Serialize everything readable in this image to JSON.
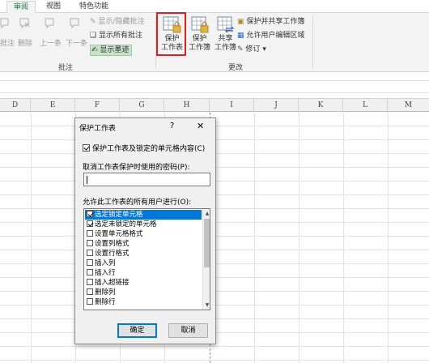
{
  "ribbon": {
    "tabs": [
      {
        "label": "审阅",
        "active": true
      },
      {
        "label": "视图",
        "active": false
      },
      {
        "label": "特色功能",
        "active": false
      }
    ],
    "comments_group": {
      "label": "批注",
      "partial_label": "批注",
      "delete": "删除",
      "previous": "上一条",
      "next": "下一条",
      "show_hide": "显示/隐藏批注",
      "show_all": "显示所有批注",
      "show_ink": "显示墨迹"
    },
    "changes_group": {
      "label": "更改",
      "protect_sheet": [
        "保护",
        "工作表"
      ],
      "protect_workbook": [
        "保护",
        "工作簿"
      ],
      "share_workbook": [
        "共享",
        "工作簿"
      ],
      "protect_and_share": "保护并共享工作簿",
      "allow_edit_ranges": "允许用户编辑区域",
      "track_changes": "修订"
    }
  },
  "sheet": {
    "columns": [
      "D",
      "E",
      "F",
      "G",
      "H",
      "I",
      "J",
      "K",
      "L",
      "M"
    ]
  },
  "dialog": {
    "title": "保护工作表",
    "help": "?",
    "close": "✕",
    "protect_checkbox_label": "保护工作表及锁定的单元格内容(C)",
    "protect_checked": true,
    "password_label": "取消工作表保护时使用的密码(P):",
    "password_value": "",
    "allow_label": "允许此工作表的所有用户进行(O):",
    "permissions": [
      {
        "label": "选定锁定单元格",
        "checked": true,
        "selected": true
      },
      {
        "label": "选定未锁定的单元格",
        "checked": true,
        "selected": false
      },
      {
        "label": "设置单元格格式",
        "checked": false,
        "selected": false
      },
      {
        "label": "设置列格式",
        "checked": false,
        "selected": false
      },
      {
        "label": "设置行格式",
        "checked": false,
        "selected": false
      },
      {
        "label": "插入列",
        "checked": false,
        "selected": false
      },
      {
        "label": "插入行",
        "checked": false,
        "selected": false
      },
      {
        "label": "插入超链接",
        "checked": false,
        "selected": false
      },
      {
        "label": "删除列",
        "checked": false,
        "selected": false
      },
      {
        "label": "删除行",
        "checked": false,
        "selected": false
      }
    ],
    "ok": "确定",
    "cancel": "取消"
  },
  "colors": {
    "accent_green": "#217346",
    "highlight_red": "#e0201f",
    "selection_blue": "#0078d7"
  }
}
